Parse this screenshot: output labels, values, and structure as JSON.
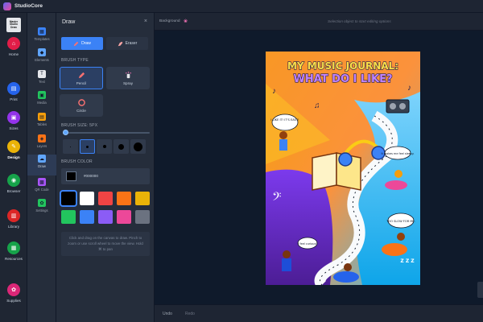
{
  "app": {
    "title": "StudioCore",
    "brand_lines": [
      "Master",
      "Studio",
      "Draw"
    ]
  },
  "rail": [
    {
      "label": "Home",
      "icon": "home-icon",
      "color": "#e11d48",
      "glyph": "⌂"
    },
    {
      "label": "Print",
      "icon": "print-icon",
      "color": "#2563eb",
      "glyph": "▤"
    },
    {
      "label": "Sizes",
      "icon": "sizes-icon",
      "color": "#9333ea",
      "glyph": "▣"
    },
    {
      "label": "Design",
      "icon": "design-icon",
      "color": "#eab308",
      "glyph": "✎",
      "active": true
    },
    {
      "label": "Browser",
      "icon": "browser-icon",
      "color": "#16a34a",
      "glyph": "◉"
    },
    {
      "label": "Library",
      "icon": "library-icon",
      "color": "#dc2626",
      "glyph": "▥"
    },
    {
      "label": "Resources",
      "icon": "resources-icon",
      "color": "#16a34a",
      "glyph": "▦"
    },
    {
      "label": "Supplies",
      "icon": "supplies-icon",
      "color": "#db2777",
      "glyph": "✿"
    }
  ],
  "tools": [
    {
      "label": "Templates",
      "icon": "templates-icon",
      "color": "#3b82f6"
    },
    {
      "label": "Elements",
      "icon": "elements-icon",
      "color": "#60a5fa"
    },
    {
      "label": "Text",
      "icon": "text-icon",
      "color": "#e5e7eb"
    },
    {
      "label": "Media",
      "icon": "media-icon",
      "color": "#22c55e"
    },
    {
      "label": "Tables",
      "icon": "tables-icon",
      "color": "#f59e0b"
    },
    {
      "label": "Layers",
      "icon": "layers-icon",
      "color": "#f97316"
    },
    {
      "label": "Draw",
      "icon": "draw-cloud-icon",
      "color": "#60a5fa",
      "active": true
    },
    {
      "label": "QR Code",
      "icon": "qr-code-icon",
      "color": "#a855f7"
    },
    {
      "label": "Settings",
      "icon": "settings-icon",
      "color": "#22c55e"
    }
  ],
  "panel": {
    "title": "Draw",
    "close": "×",
    "draw_label": "Draw",
    "eraser_label": "Eraser",
    "brush_type_label": "BRUSH TYPE",
    "brush_types": [
      {
        "label": "Pencil",
        "icon": "pencil-icon",
        "active": true
      },
      {
        "label": "Spray",
        "icon": "spray-icon"
      },
      {
        "label": "Circle",
        "icon": "circle-icon"
      }
    ],
    "brush_size_label": "BRUSH SIZE: 5PX",
    "brush_size_px": 5,
    "brush_size_fraction": 0.03,
    "brush_color_label": "BRUSH COLOR",
    "brush_color_hex": "#000000",
    "swatches": [
      "#000000",
      "#ffffff",
      "#ef4444",
      "#f97316",
      "#eab308",
      "#22c55e",
      "#3b82f6",
      "#8b5cf6",
      "#ec4899",
      "#6b7280"
    ],
    "hint": "Click and drag on the canvas to draw. Pinch to zoom or use scroll wheel to move the view. Hold ⌘ to pan"
  },
  "topbar": {
    "background_label": "Background",
    "hint": "Selection object to start editing options"
  },
  "bottombar": {
    "undo": "Undo",
    "redo": "Redo"
  },
  "poster": {
    "title_line1": "MY MUSIC JOURNAL:",
    "title_line2": "WHAT DO I LIKE?",
    "bubble_easy": "I LIKE IT! IT'S EASY!",
    "bubble_sleep": "It makes me feel sleepy.",
    "bubble_slow": "TOO SLOW FOR ME.",
    "bubble_curious": "I feel curious!",
    "zzz": "Z Z Z"
  }
}
